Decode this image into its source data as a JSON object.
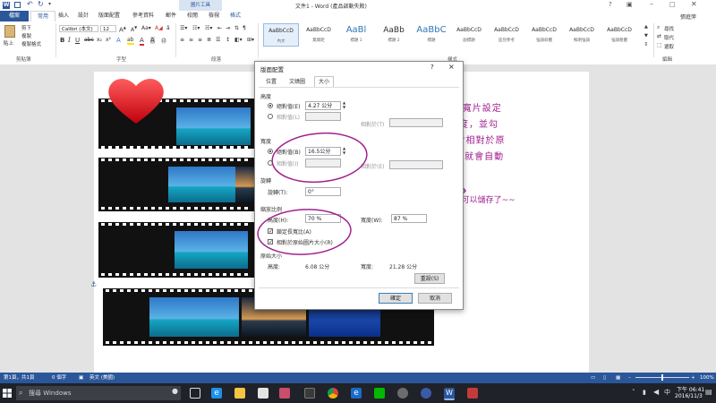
{
  "window": {
    "title": "文件1 - Word (產品啟動失敗)",
    "context_label": "圖片工具",
    "user": "張庭萍"
  },
  "tabs": [
    "檔案",
    "常用",
    "插入",
    "設計",
    "版面配置",
    "參考資料",
    "郵件",
    "校閱",
    "檢視",
    "格式"
  ],
  "ribbon": {
    "clipboard": {
      "label": "剪貼簿",
      "paste": "貼上",
      "cut": "剪下",
      "copy": "複製",
      "format_painter": "複製格式"
    },
    "font": {
      "label": "字型",
      "name": "Calibri (本文)",
      "size": "12"
    },
    "paragraph": {
      "label": "段落"
    },
    "styles": {
      "label": "樣式",
      "items": [
        {
          "sample": "AaBbCcD",
          "name": "內文"
        },
        {
          "sample": "AaBbCcD",
          "name": "無間距"
        },
        {
          "sample": "AaBl",
          "name": "標題 1"
        },
        {
          "sample": "AaBb",
          "name": "標題 2"
        },
        {
          "sample": "AaBbC",
          "name": "標題"
        },
        {
          "sample": "AaBbCcD",
          "name": "副標題"
        },
        {
          "sample": "AaBbCcD",
          "name": "區別參考"
        },
        {
          "sample": "AaBbCcD",
          "name": "強調斜體"
        },
        {
          "sample": "AaBbCcD",
          "name": "鮮明強調"
        },
        {
          "sample": "AaBbCcD",
          "name": "強調粗體"
        }
      ]
    },
    "editing": {
      "label": "編輯",
      "find": "尋找",
      "replace": "取代",
      "select": "選取"
    }
  },
  "dialog": {
    "title": "版面配置",
    "help": "?",
    "close": "×",
    "tabs": [
      "位置",
      "文繞圖",
      "大小"
    ],
    "height_section": "高度",
    "height_absolute_label": "絕對值(E)",
    "height_absolute_value": "4.27 公分",
    "height_relative_label": "相對值(L)",
    "height_relative_to": "相對於(T)",
    "width_section": "寬度",
    "width_absolute_label": "絕對值(B)",
    "width_absolute_value": "16.5公分",
    "width_relative_label": "相對值(I)",
    "width_relative_to": "相對於(E)",
    "rotate_section": "旋轉",
    "rotation_label": "旋轉(T):",
    "rotation_value": "0°",
    "scale_section": "縮放比例",
    "scale_height_label": "高度(H):",
    "scale_height_value": "70 %",
    "scale_width_label": "寬度(W):",
    "scale_width_value": "87 %",
    "lock_aspect": "鎖定長寬比(A)",
    "relative_to_original": "相對於原始圖片大小(R)",
    "original_section": "原始大小",
    "orig_height_label": "高度:",
    "orig_height_value": "6.08 公分",
    "orig_width_label": "寬度:",
    "orig_width_value": "21.28 公分",
    "reset": "重設(S)",
    "ok": "確定",
    "cancel": "取消"
  },
  "annotations": {
    "step15_lines": [
      "15、點選有紅圈的寬片設定",
      "調整紅圈的寬片寬度，並勾",
      "選“鎖定長寬比”、“相對於原",
      "始圖片大小”，高度就會自動",
      "調整。"
    ],
    "step16": "16、完成啦~~可以儲存了~~",
    "ink_color": "#a0208f",
    "circle_color": "#a0208f"
  },
  "statusbar": {
    "page": "第1頁，共1頁",
    "words": "0 個字",
    "language": "英文 (美國)",
    "zoom": "100%"
  },
  "taskbar": {
    "search_placeholder": "搜尋 Windows",
    "time": "下午 06:41",
    "date": "2016/11/3"
  },
  "colors": {
    "word_blue": "#2b579a",
    "film": "#111111",
    "heart": "#e8131b",
    "sea": "#1aa3c8"
  }
}
